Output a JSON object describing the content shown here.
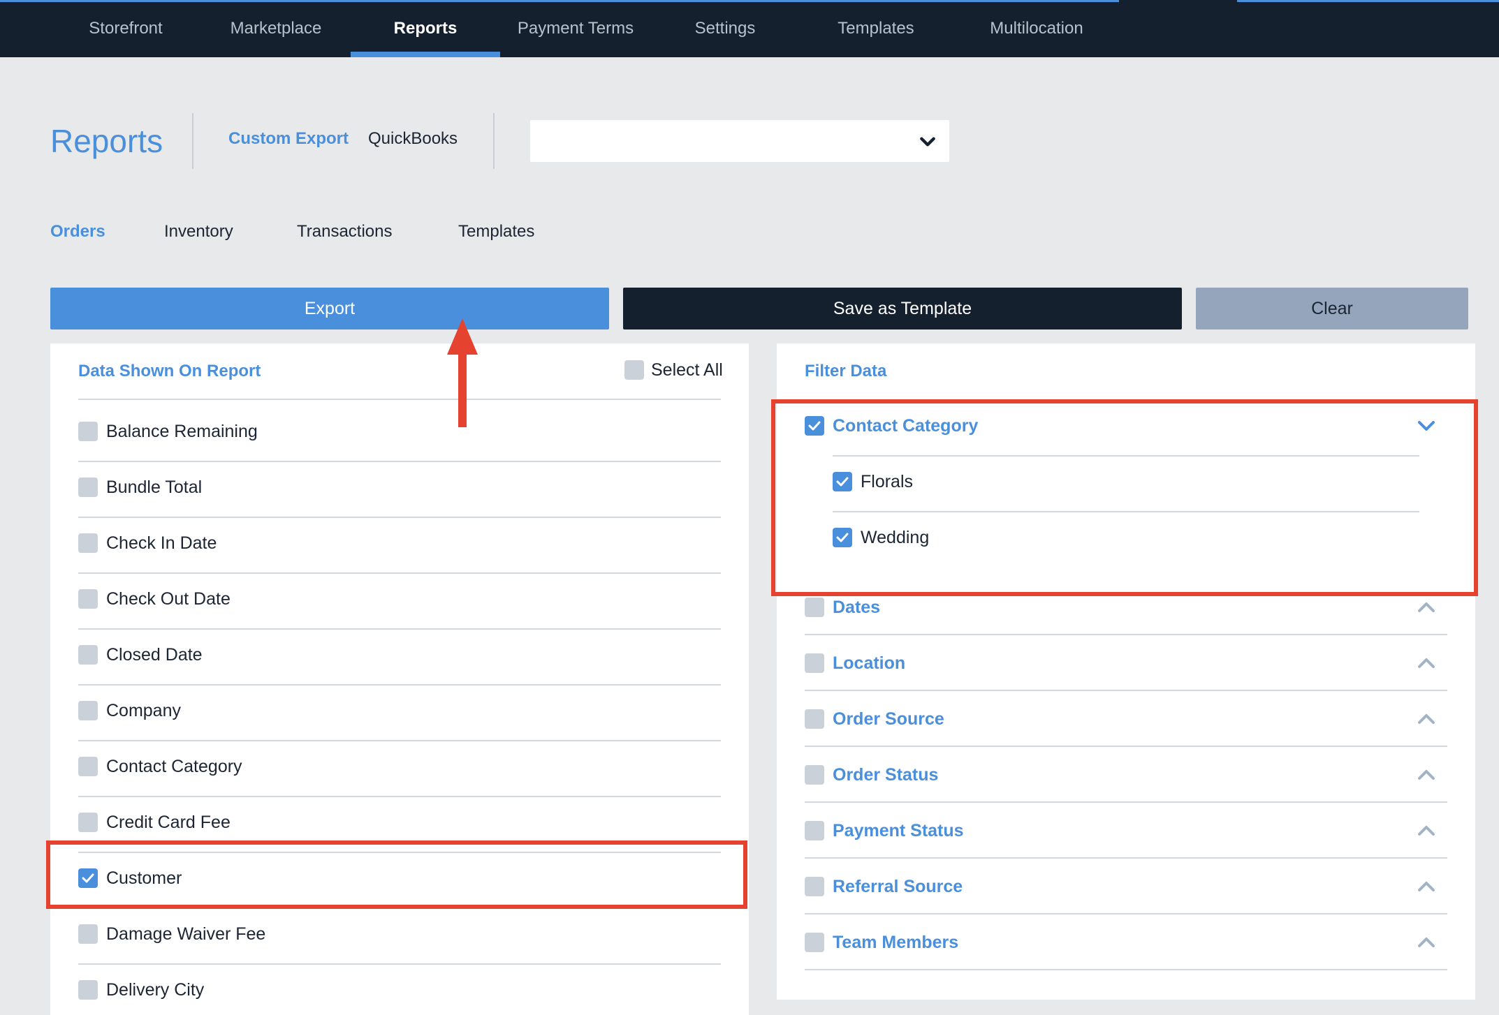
{
  "topnav": {
    "items": [
      {
        "label": "Storefront"
      },
      {
        "label": "Marketplace"
      },
      {
        "label": "Reports"
      },
      {
        "label": "Payment Terms"
      },
      {
        "label": "Settings"
      },
      {
        "label": "Templates"
      },
      {
        "label": "Multilocation"
      }
    ],
    "active": "Reports"
  },
  "header": {
    "title": "Reports",
    "links": [
      {
        "label": "Custom Export",
        "active": true
      },
      {
        "label": "QuickBooks",
        "active": false
      }
    ],
    "select": {
      "value": ""
    }
  },
  "subtabs": [
    {
      "label": "Orders",
      "active": true
    },
    {
      "label": "Inventory"
    },
    {
      "label": "Transactions"
    },
    {
      "label": "Templates"
    }
  ],
  "actions": {
    "export_label": "Export",
    "save_template_label": "Save as Template",
    "clear_label": "Clear"
  },
  "data_panel": {
    "title": "Data Shown On Report",
    "select_all_label": "Select All",
    "select_all_checked": false,
    "fields": [
      {
        "label": "Balance Remaining",
        "checked": false
      },
      {
        "label": "Bundle Total",
        "checked": false
      },
      {
        "label": "Check In Date",
        "checked": false
      },
      {
        "label": "Check Out Date",
        "checked": false
      },
      {
        "label": "Closed Date",
        "checked": false
      },
      {
        "label": "Company",
        "checked": false
      },
      {
        "label": "Contact Category",
        "checked": false
      },
      {
        "label": "Credit Card Fee",
        "checked": false
      },
      {
        "label": "Customer",
        "checked": true
      },
      {
        "label": "Damage Waiver Fee",
        "checked": false
      },
      {
        "label": "Delivery City",
        "checked": false
      }
    ]
  },
  "filter_panel": {
    "title": "Filter Data",
    "groups": [
      {
        "label": "Contact Category",
        "checked": true,
        "expanded": true,
        "options": [
          {
            "label": "Florals",
            "checked": true
          },
          {
            "label": "Wedding",
            "checked": true
          }
        ]
      },
      {
        "label": "Dates",
        "checked": false,
        "expanded": false
      },
      {
        "label": "Location",
        "checked": false,
        "expanded": false
      },
      {
        "label": "Order Source",
        "checked": false,
        "expanded": false
      },
      {
        "label": "Order Status",
        "checked": false,
        "expanded": false
      },
      {
        "label": "Payment Status",
        "checked": false,
        "expanded": false
      },
      {
        "label": "Referral Source",
        "checked": false,
        "expanded": false
      },
      {
        "label": "Team Members",
        "checked": false,
        "expanded": false
      }
    ]
  },
  "colors": {
    "nav_bg": "#15202e",
    "accent": "#4a8fdc",
    "annotation": "#e5432f",
    "clear_button": "#95a6bc"
  },
  "icons": [
    "chevron-down-icon",
    "chevron-up-icon",
    "check-icon",
    "arrow-up-icon"
  ]
}
